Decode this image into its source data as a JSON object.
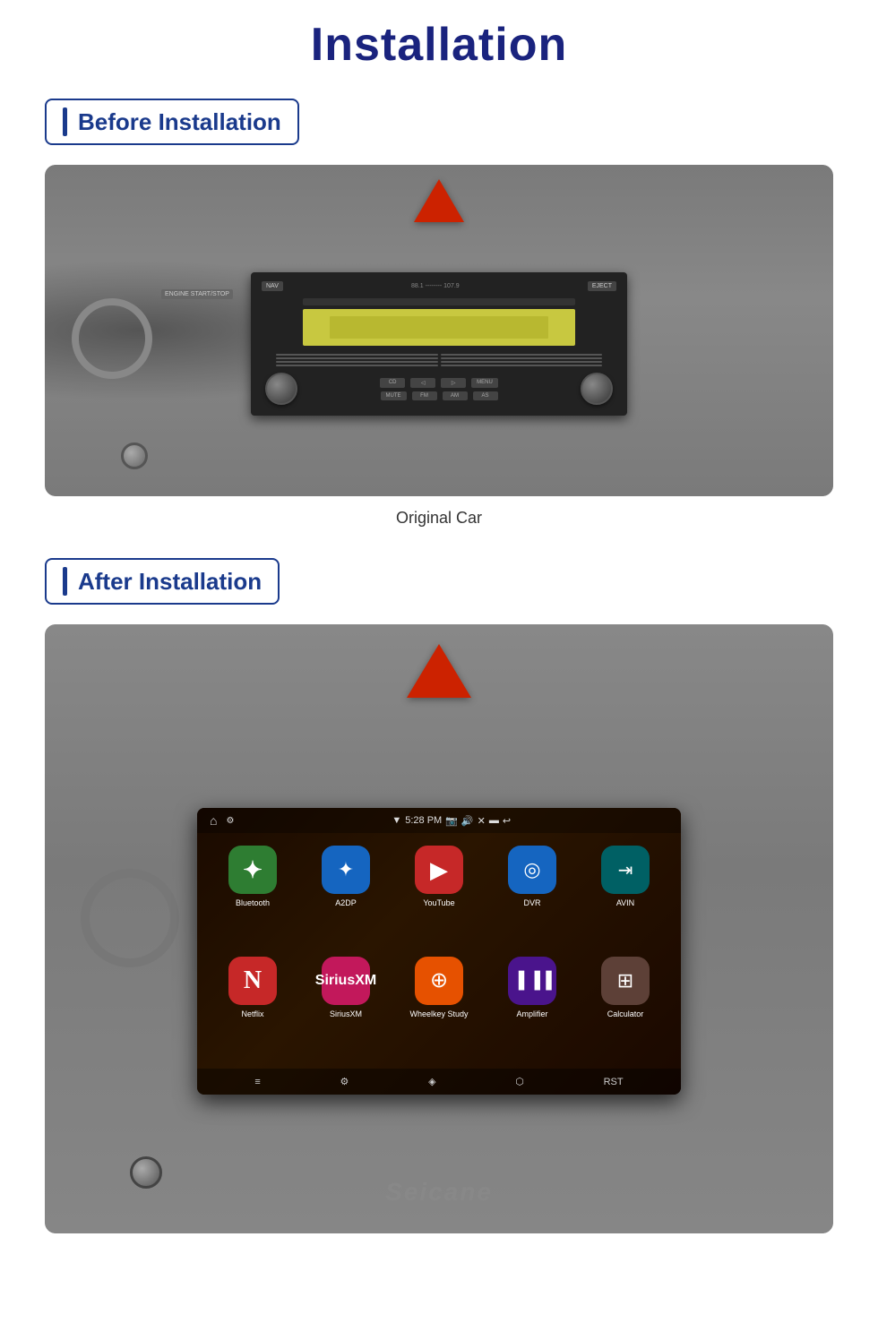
{
  "page": {
    "title": "Installation",
    "before_section": {
      "label": "Before Installation",
      "image_caption": "Original Car"
    },
    "after_section": {
      "label": "After Installation"
    }
  },
  "android_unit": {
    "status_bar": {
      "time": "5:28 PM",
      "signal_icon": "▼",
      "home_symbol": "⌂",
      "nav_symbol": "⚙"
    },
    "apps": [
      {
        "name": "Bluetooth",
        "bg_class": "app-bluetooth",
        "icon": "𝔹",
        "unicode": "✦"
      },
      {
        "name": "A2DP",
        "bg_class": "app-a2dp",
        "icon": "✦"
      },
      {
        "name": "YouTube",
        "bg_class": "app-youtube",
        "icon": "▶"
      },
      {
        "name": "DVR",
        "bg_class": "app-dvr",
        "icon": "◎"
      },
      {
        "name": "AVIN",
        "bg_class": "app-avin",
        "icon": "⇥"
      },
      {
        "name": "Netflix",
        "bg_class": "app-netflix",
        "icon": "N"
      },
      {
        "name": "SiriusXM",
        "bg_class": "app-siriusxm",
        "icon": "S"
      },
      {
        "name": "Wheelkey Study",
        "bg_class": "app-wheelkey",
        "icon": "⊕"
      },
      {
        "name": "Amplifier",
        "bg_class": "app-amplifier",
        "icon": "▐▐"
      },
      {
        "name": "Calculator",
        "bg_class": "app-calculator",
        "icon": "⊞"
      }
    ],
    "seicane_label": "Seicane"
  },
  "radio_labels": {
    "eject": "EJECT",
    "cd": "CD",
    "mute": "MUTE",
    "fm": "FM",
    "am": "AM",
    "as": "AS",
    "menu": "MENU",
    "engine": "ENGINE START/STOP"
  }
}
